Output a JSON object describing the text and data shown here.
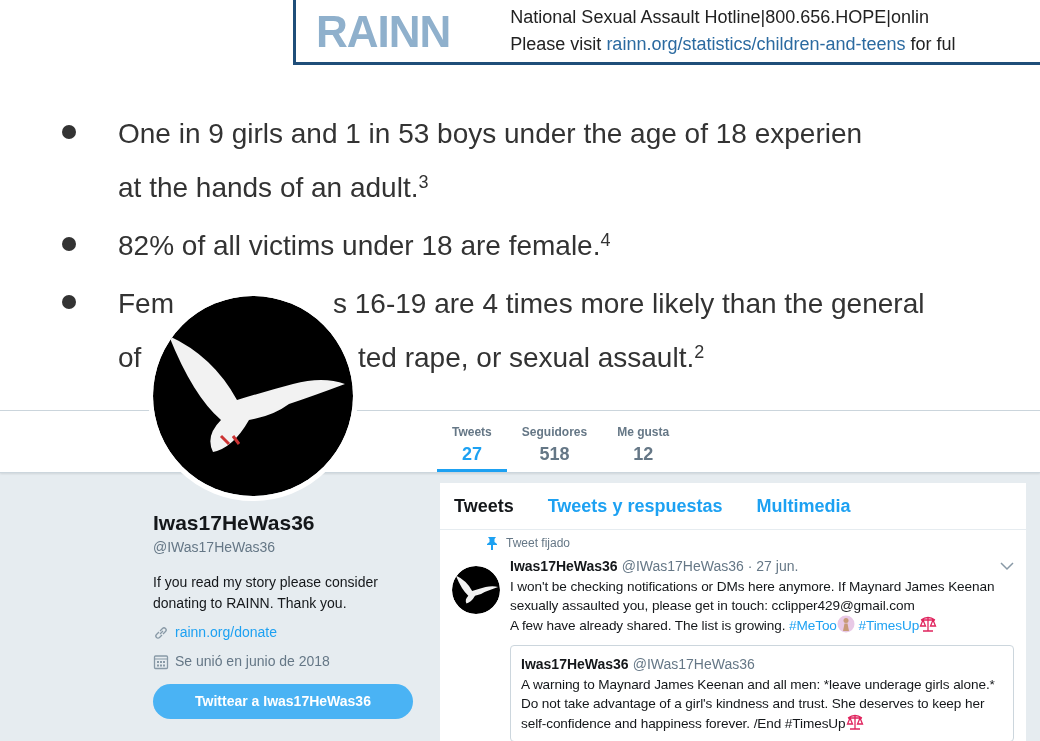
{
  "banner": {
    "logo": "RAINN",
    "hotline": "National Sexual Assault Hotline|800.656.HOPE|onlin",
    "visit_before": "Please visit",
    "visit_link": "rainn.org/statistics/children-and-teens",
    "visit_after": "for ful",
    "bullets": [
      {
        "lines": [
          [
            "One in 9 girls and 1 in 53 boys under the age of 18 experien"
          ],
          [
            "at the hands of an adult.$^{3}$"
          ]
        ]
      },
      {
        "lines": [
          [
            "82% of all victims under 18 are female.$^{4}$"
          ]
        ]
      },
      {
        "lines": [
          [
            "Fem",
            "s 16-19 are 4 times more likely than the general"
          ],
          [
            "of",
            "ted rape, or sexual assault.$^{2}$"
          ]
        ]
      }
    ]
  },
  "stats": [
    {
      "label": "Tweets",
      "value": "27",
      "selected": true
    },
    {
      "label": "Seguidores",
      "value": "518",
      "selected": false
    },
    {
      "label": "Me gusta",
      "value": "12",
      "selected": false
    }
  ],
  "profile": {
    "name": "Iwas17HeWas36",
    "handle": "@IWas17HeWas36",
    "bio": "If you read my story please consider donating to RAINN. Thank you.",
    "link": "rainn.org/donate",
    "joined": "Se unió en junio de 2018",
    "tweet_button": "Twittear a Iwas17HeWas36"
  },
  "timeline_tabs": [
    {
      "label": "Tweets",
      "selected": true
    },
    {
      "label": "Tweets y respuestas",
      "selected": false
    },
    {
      "label": "Multimedia",
      "selected": false
    }
  ],
  "tweet": {
    "pinned_label": "Tweet fijado",
    "name": "Iwas17HeWas36",
    "handle": "@IWas17HeWas36",
    "date": "· 27 jun.",
    "segments": [
      {
        "kind": "text",
        "text": "I won't be checking notifications or DMs here anymore. If Maynard James Keenan sexually assaulted you, please get in touch: cclipper429@gmail.com"
      },
      {
        "kind": "break"
      },
      {
        "kind": "text",
        "text": "A few have already shared. The list is growing. "
      },
      {
        "kind": "hashtag",
        "text": "#MeToo"
      },
      {
        "kind": "person"
      },
      {
        "kind": "space"
      },
      {
        "kind": "hashtag",
        "text": "#TimesUp"
      },
      {
        "kind": "scales"
      }
    ],
    "quote": {
      "name": "Iwas17HeWas36",
      "handle": "@IWas17HeWas36",
      "segments": [
        {
          "kind": "text",
          "text": "A warning to Maynard James Keenan and all men: *leave underage girls alone.* Do not take advantage of a girl's kindness and trust. She deserves to keep her self-confidence and happiness forever. /End #TimesUp"
        },
        {
          "kind": "scales"
        }
      ]
    }
  }
}
